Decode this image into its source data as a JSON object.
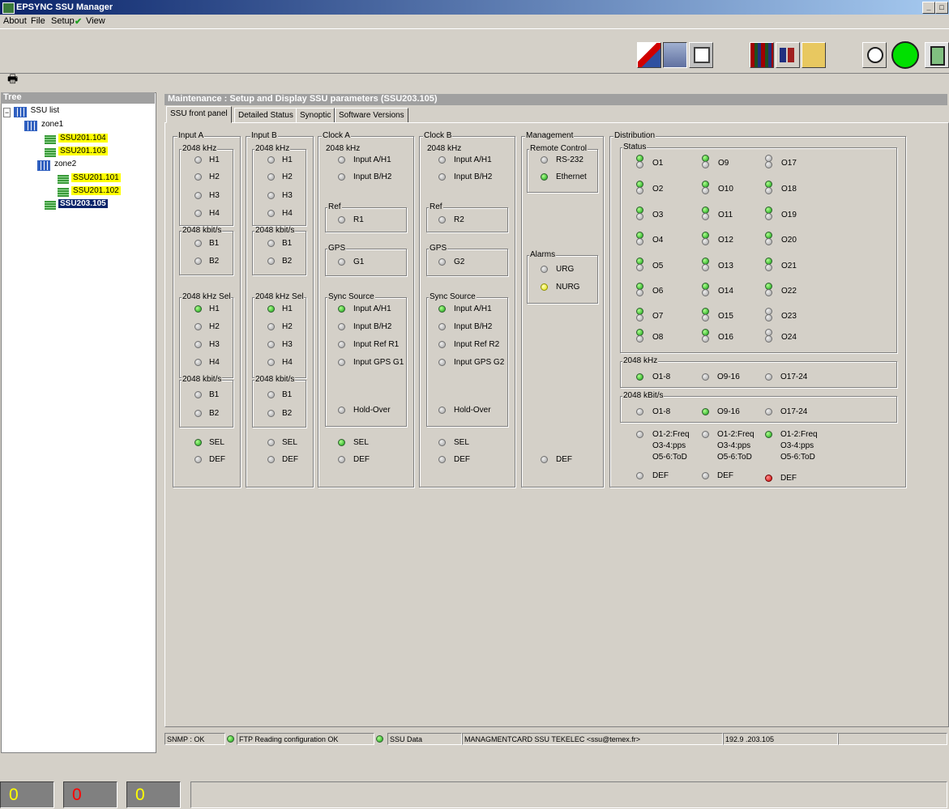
{
  "window": {
    "title": "EPSYNC SSU Manager",
    "controls": [
      "_",
      "□"
    ]
  },
  "menu": [
    "About",
    "File",
    "Setup",
    "View"
  ],
  "toolbar_icons": [
    "config-icon",
    "network-icon",
    "display-icon",
    "books-icon",
    "users-icon",
    "folder-icon",
    "clock-alarm-icon",
    "clock-icon",
    "exit-icon"
  ],
  "tree": {
    "title": "Tree",
    "items": [
      {
        "label": "SSU list",
        "highlight": "none"
      },
      {
        "label": "zone1",
        "highlight": "none"
      },
      {
        "label": "SSU201.104",
        "highlight": "yellow"
      },
      {
        "label": "SSU201.103",
        "highlight": "yellow"
      },
      {
        "label": "zone2",
        "highlight": "none"
      },
      {
        "label": "SSU201.101",
        "highlight": "yellow"
      },
      {
        "label": "SSU201.102",
        "highlight": "yellow"
      },
      {
        "label": "SSU203.105",
        "highlight": "selected"
      }
    ]
  },
  "main": {
    "title": "Maintenance : Setup and Display SSU parameters (SSU203.105)",
    "tabs": [
      "SSU front panel",
      "Detailed Status",
      "Synoptic",
      "Software Versions"
    ],
    "active_tab": 0
  },
  "panel": {
    "input_a": {
      "title": "Input A",
      "khz": "2048 kHz",
      "h": [
        "H1",
        "H2",
        "H3",
        "H4"
      ],
      "kbit": "2048 kbit/s",
      "b": [
        "B1",
        "B2"
      ],
      "sel_title": "2048 kHz Sel",
      "sel_h": [
        "H1",
        "H2",
        "H3",
        "H4"
      ],
      "sel_kbit": "2048 kbit/s",
      "sel_b": [
        "B1",
        "B2"
      ],
      "sel": "SEL",
      "def": "DEF"
    },
    "input_b": {
      "title": "Input B",
      "khz": "2048 kHz",
      "h": [
        "H1",
        "H2",
        "H3",
        "H4"
      ],
      "kbit": "2048 kbit/s",
      "b": [
        "B1",
        "B2"
      ],
      "sel_title": "2048 kHz Sel",
      "sel_h": [
        "H1",
        "H2",
        "H3",
        "H4"
      ],
      "sel_kbit": "2048 kbit/s",
      "sel_b": [
        "B1",
        "B2"
      ],
      "sel": "SEL",
      "def": "DEF"
    },
    "clock_a": {
      "title": "Clock A",
      "khz": "2048 kHz",
      "inputs": [
        "Input A/H1",
        "Input B/H2"
      ],
      "ref_title": "Ref",
      "ref": "R1",
      "gps_title": "GPS",
      "gps": "G1",
      "sync_title": "Sync Source",
      "sync": [
        "Input A/H1",
        "Input B/H2",
        "Input Ref R1",
        "Input GPS G1"
      ],
      "hold": "Hold-Over",
      "sel": "SEL",
      "def": "DEF"
    },
    "clock_b": {
      "title": "Clock B",
      "khz": "2048 kHz",
      "inputs": [
        "Input A/H1",
        "Input B/H2"
      ],
      "ref_title": "Ref",
      "ref": "R2",
      "gps_title": "GPS",
      "gps": "G2",
      "sync_title": "Sync Source",
      "sync": [
        "Input A/H1",
        "Input B/H2",
        "Input Ref R2",
        "Input GPS G2"
      ],
      "hold": "Hold-Over",
      "sel": "SEL",
      "def": "DEF"
    },
    "management": {
      "title": "Management",
      "rc_title": "Remote Control",
      "rc": [
        "RS-232",
        "Ethernet"
      ],
      "alarms_title": "Alarms",
      "alarms": [
        "URG",
        "NURG"
      ],
      "def": "DEF"
    },
    "distribution": {
      "title": "Distribution",
      "status_title": "Status",
      "outputs": [
        "O1",
        "O2",
        "O3",
        "O4",
        "O5",
        "O6",
        "O7",
        "O8",
        "O9",
        "O10",
        "O11",
        "O12",
        "O13",
        "O14",
        "O15",
        "O16",
        "O17",
        "O18",
        "O19",
        "O20",
        "O21",
        "O22",
        "O23",
        "O24"
      ],
      "khz_title": "2048 kHz",
      "khz": [
        "O1-8",
        "O9-16",
        "O17-24"
      ],
      "kbit_title": "2048 kBit/s",
      "kbit": [
        "O1-8",
        "O9-16",
        "O17-24"
      ],
      "freq": [
        "O1-2:Freq",
        "O3-4:pps",
        "O5-6:ToD"
      ],
      "def": "DEF"
    }
  },
  "leds": {
    "input_a_sel_h1": "green",
    "input_b_sel_h1": "green",
    "input_a_sel": "green",
    "clock_a_sync1": "green",
    "clock_a_sel": "green",
    "clock_b_sync1": "green",
    "ethernet": "green",
    "nurg": "yellow",
    "khz_o1_8": "green",
    "kbit_o9_16": "green",
    "freq3": "green",
    "def3": "red"
  },
  "status_green_outputs_top": [
    "O1",
    "O2",
    "O3",
    "O4",
    "O5",
    "O6",
    "O7",
    "O8",
    "O9",
    "O10",
    "O11",
    "O12",
    "O13",
    "O14",
    "O15",
    "O16",
    "O18",
    "O19",
    "O20",
    "O21",
    "O22"
  ],
  "statusbar": {
    "snmp": "SNMP : OK",
    "ftp": "FTP Reading configuration OK",
    "ssu": "SSU Data",
    "card": "MANAGMENTCARD SSU TEKELEC <ssu@temex.fr>",
    "ip": "192.9  .203.105"
  },
  "counters": [
    {
      "value": "0",
      "color": "#ffff00"
    },
    {
      "value": "0",
      "color": "#ff0000"
    },
    {
      "value": "0",
      "color": "#ffff00"
    }
  ]
}
